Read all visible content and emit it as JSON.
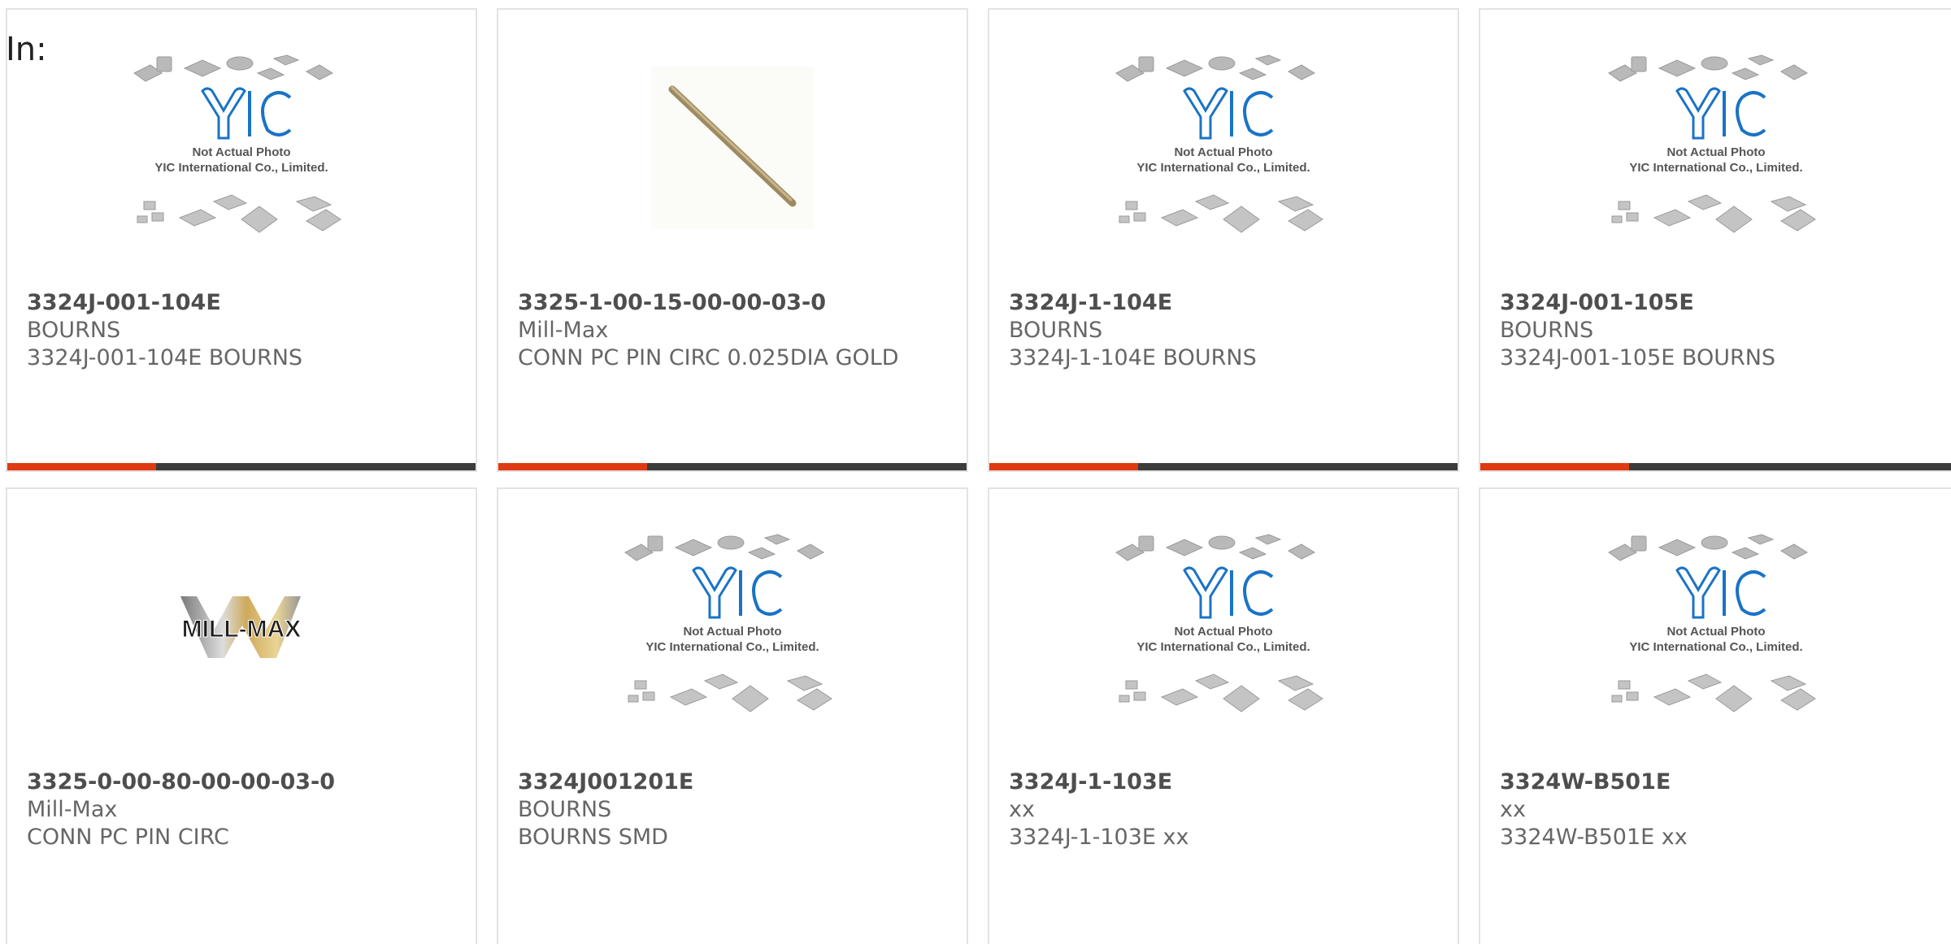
{
  "page": {
    "label": "In:"
  },
  "colors": {
    "accent": "#e03a12",
    "bar": "#3c3c3c",
    "border": "#e3e3e3",
    "yic_blue": "#1a73c6"
  },
  "placeholder": {
    "line1": "Not Actual Photo",
    "line2": "YIC International Co., Limited.",
    "logo": "YIC"
  },
  "products": [
    {
      "part": "3324J-001-104E",
      "brand": "BOURNS",
      "desc": "3324J-001-104E BOURNS",
      "image": "yic-placeholder"
    },
    {
      "part": "3325-1-00-15-00-00-03-0",
      "brand": "Mill-Max",
      "desc": "CONN PC PIN CIRC 0.025DIA GOLD",
      "image": "pin-photo"
    },
    {
      "part": "3324J-1-104E",
      "brand": "BOURNS",
      "desc": "3324J-1-104E BOURNS",
      "image": "yic-placeholder"
    },
    {
      "part": "3324J-001-105E",
      "brand": "BOURNS",
      "desc": "3324J-001-105E BOURNS",
      "image": "yic-placeholder"
    },
    {
      "part": "3325-0-00-80-00-00-03-0",
      "brand": "Mill-Max",
      "desc": "CONN PC PIN CIRC",
      "image": "mill-max-logo",
      "logo_text": "MILL-MAX"
    },
    {
      "part": "3324J001201E",
      "brand": "BOURNS",
      "desc": "BOURNS SMD",
      "image": "yic-placeholder"
    },
    {
      "part": "3324J-1-103E",
      "brand": "xx",
      "desc": "3324J-1-103E xx",
      "image": "yic-placeholder"
    },
    {
      "part": "3324W-B501E",
      "brand": "xx",
      "desc": "3324W-B501E xx",
      "image": "yic-placeholder"
    }
  ]
}
